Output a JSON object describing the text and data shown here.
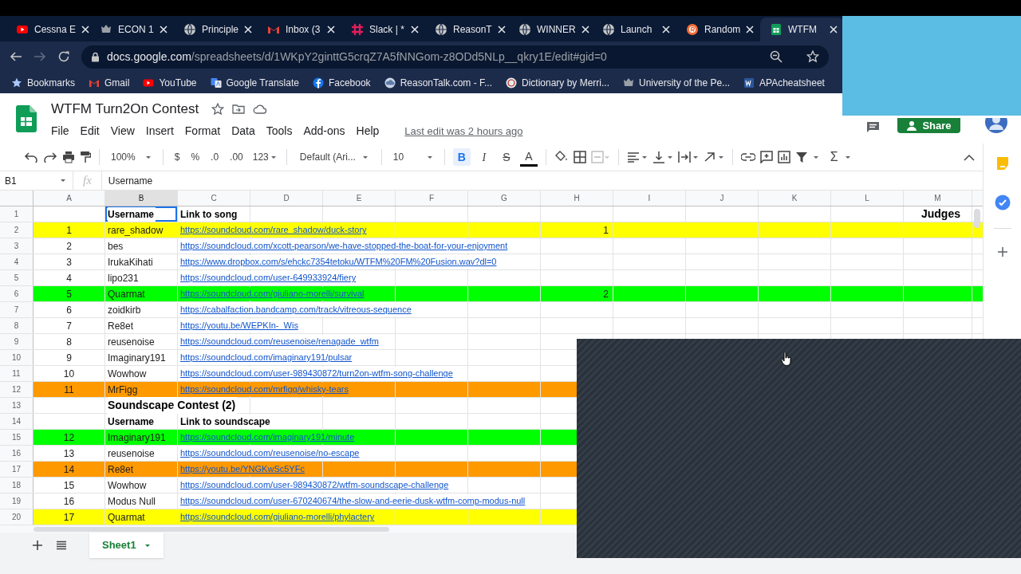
{
  "browser": {
    "tabs": [
      {
        "title": "Cessna E",
        "selected": false
      },
      {
        "title": "ECON 1",
        "selected": false
      },
      {
        "title": "Principle",
        "selected": false
      },
      {
        "title": "Inbox (3",
        "selected": false
      },
      {
        "title": "Slack | *",
        "selected": false
      },
      {
        "title": "ReasonT",
        "selected": false
      },
      {
        "title": "WINNER",
        "selected": false
      },
      {
        "title": "Launch",
        "selected": false
      },
      {
        "title": "Random",
        "selected": false
      },
      {
        "title": "WTFM",
        "selected": true
      }
    ],
    "url": "docs.google.com/spreadsheets/d/1WKpY2ginttG5crqZ7A5fNNGom-z8ODd5NLp__qkry1E/edit#gid=0",
    "bookmarks": [
      "Bookmarks",
      "Gmail",
      "YouTube",
      "Google Translate",
      "Facebook",
      "ReasonTalk.com - F...",
      "Dictionary by Merri...",
      "University of the Pe...",
      "APAcheatsheet"
    ]
  },
  "document": {
    "title": "WTFM Turn2On Contest",
    "menu": [
      "File",
      "Edit",
      "View",
      "Insert",
      "Format",
      "Data",
      "Tools",
      "Add-ons",
      "Help"
    ],
    "last_edit": "Last edit was 2 hours ago",
    "share": "Share"
  },
  "toolbar": {
    "zoom": "100%",
    "currency": "$",
    "percent": "%",
    "decimal_less": ".0",
    "decimal_more": ".00",
    "number_format": "123",
    "font": "Default (Ari...",
    "font_size": "10",
    "bold": {
      "label": "B",
      "on": true
    },
    "italic": "I",
    "strikethrough": "S",
    "text_color": "A",
    "functions": "Σ"
  },
  "formula_bar": {
    "cell": "B1",
    "fx": "fx",
    "content": "Username"
  },
  "columns": [
    {
      "label": "A",
      "selected": false
    },
    {
      "label": "B",
      "selected": true
    },
    {
      "label": "C",
      "selected": false
    },
    {
      "label": "D",
      "selected": false
    },
    {
      "label": "E",
      "selected": false
    },
    {
      "label": "F",
      "selected": false
    },
    {
      "label": "G",
      "selected": false
    },
    {
      "label": "H",
      "selected": false
    },
    {
      "label": "I",
      "selected": false
    },
    {
      "label": "J",
      "selected": false
    },
    {
      "label": "K",
      "selected": false
    },
    {
      "label": "L",
      "selected": false
    },
    {
      "label": "M",
      "selected": false
    }
  ],
  "rows": [
    {
      "number": "1",
      "cells": {
        "b": {
          "kind": "heading",
          "text": "Username",
          "selected": true
        },
        "c": {
          "kind": "heading",
          "text": "Link to song",
          "selected": false
        },
        "m": {
          "kind": "judges",
          "text": "Judges",
          "selected": false
        }
      }
    },
    {
      "number": "2",
      "color": "#ffff00",
      "cells": {
        "a": {
          "kind": "number",
          "text": "1",
          "selected": false
        },
        "b": {
          "kind": "text",
          "text": "rare_shadow",
          "selected": false
        },
        "c": {
          "kind": "link",
          "text": "https://soundcloud.com/rare_shadow/duck-story",
          "selected": false
        },
        "h": {
          "kind": "value",
          "text": "1",
          "selected": false
        }
      }
    },
    {
      "number": "3",
      "cells": {
        "a": {
          "kind": "number",
          "text": "2",
          "selected": false
        },
        "b": {
          "kind": "text",
          "text": "bes",
          "selected": false
        },
        "c": {
          "kind": "link",
          "text": "https://soundcloud.com/xcott-pearson/we-have-stopped-the-boat-for-your-enjoyment",
          "selected": false
        }
      }
    },
    {
      "number": "4",
      "cells": {
        "a": {
          "kind": "number",
          "text": "3",
          "selected": false
        },
        "b": {
          "kind": "text",
          "text": "IrukaKihati",
          "selected": false
        },
        "c": {
          "kind": "link",
          "text": "https://www.dropbox.com/s/ehckc7354tetoku/WTFM%20FM%20Fusion.wav?dl=0",
          "selected": false
        }
      }
    },
    {
      "number": "5",
      "cells": {
        "a": {
          "kind": "number",
          "text": "4",
          "selected": false
        },
        "b": {
          "kind": "text",
          "text": "lipo231",
          "selected": false
        },
        "c": {
          "kind": "link",
          "text": "https://soundcloud.com/user-649933924/fiery",
          "selected": false
        }
      }
    },
    {
      "number": "6",
      "color": "#00ff00",
      "cells": {
        "a": {
          "kind": "number",
          "text": "5",
          "selected": false
        },
        "b": {
          "kind": "text",
          "text": "Quarmat",
          "selected": false
        },
        "c": {
          "kind": "link",
          "text": "https://soundcloud.com/giuliano-morelli/survival",
          "selected": false
        },
        "h": {
          "kind": "value",
          "text": "2",
          "selected": false
        }
      }
    },
    {
      "number": "7",
      "cells": {
        "a": {
          "kind": "number",
          "text": "6",
          "selected": false
        },
        "b": {
          "kind": "text",
          "text": "zoidkirb",
          "selected": false
        },
        "c": {
          "kind": "link",
          "text": "https://cabalfaction.bandcamp.com/track/vitreous-sequence",
          "selected": false
        }
      }
    },
    {
      "number": "8",
      "cells": {
        "a": {
          "kind": "number",
          "text": "7",
          "selected": false
        },
        "b": {
          "kind": "text",
          "text": "Re8et",
          "selected": false
        },
        "c": {
          "kind": "link",
          "text": "https://youtu.be/WEPKIn-_Wis",
          "selected": false
        }
      }
    },
    {
      "number": "9",
      "cells": {
        "a": {
          "kind": "number",
          "text": "8",
          "selected": false
        },
        "b": {
          "kind": "text",
          "text": "reusenoise",
          "selected": false
        },
        "c": {
          "kind": "link",
          "text": "https://soundcloud.com/reusenoise/renagade_wtfm",
          "selected": false
        }
      }
    },
    {
      "number": "10",
      "cells": {
        "a": {
          "kind": "number",
          "text": "9",
          "selected": false
        },
        "b": {
          "kind": "text",
          "text": "Imaginary191",
          "selected": false
        },
        "c": {
          "kind": "link",
          "text": "https://soundcloud.com/imaginary191/pulsar",
          "selected": false
        }
      }
    },
    {
      "number": "11",
      "cells": {
        "a": {
          "kind": "number",
          "text": "10",
          "selected": false
        },
        "b": {
          "kind": "text",
          "text": "Wowhow",
          "selected": false
        },
        "c": {
          "kind": "link",
          "text": "https://soundcloud.com/user-989430872/turn2on-wtfm-song-challenge",
          "selected": false
        }
      }
    },
    {
      "number": "12",
      "color": "#ff9900",
      "cells": {
        "a": {
          "kind": "number",
          "text": "11",
          "selected": false
        },
        "b": {
          "kind": "text",
          "text": "MrFigg",
          "selected": false
        },
        "c": {
          "kind": "link",
          "text": "https://soundcloud.com/mrfigg/whisky-tears",
          "selected": false
        }
      }
    },
    {
      "number": "13",
      "cells": {
        "b": {
          "kind": "title",
          "text": "Soundscape Contest (2)",
          "selected": false
        }
      }
    },
    {
      "number": "14",
      "cells": {
        "b": {
          "kind": "heading",
          "text": "Username",
          "selected": false
        },
        "c": {
          "kind": "heading",
          "text": "Link to soundscape",
          "selected": false
        }
      }
    },
    {
      "number": "15",
      "color": "#00ff00",
      "cells": {
        "a": {
          "kind": "number",
          "text": "12",
          "selected": false
        },
        "b": {
          "kind": "text",
          "text": "Imaginary191",
          "selected": false
        },
        "c": {
          "kind": "link",
          "text": "https://soundcloud.com/imaginary191/minute",
          "selected": false
        }
      }
    },
    {
      "number": "16",
      "cells": {
        "a": {
          "kind": "number",
          "text": "13",
          "selected": false
        },
        "b": {
          "kind": "text",
          "text": "reusenoise",
          "selected": false
        },
        "c": {
          "kind": "link",
          "text": "https://soundcloud.com/reusenoise/no-escape",
          "selected": false
        }
      }
    },
    {
      "number": "17",
      "color": "#ff9900",
      "cells": {
        "a": {
          "kind": "number",
          "text": "14",
          "selected": false
        },
        "b": {
          "kind": "text",
          "text": "Re8et",
          "selected": false
        },
        "c": {
          "kind": "link",
          "text": "https://youtu.be/YNGKwSc5YFc",
          "selected": false
        }
      }
    },
    {
      "number": "18",
      "cells": {
        "a": {
          "kind": "number",
          "text": "15",
          "selected": false
        },
        "b": {
          "kind": "text",
          "text": "Wowhow",
          "selected": false
        },
        "c": {
          "kind": "link",
          "text": "https://soundcloud.com/user-989430872/wtfm-soundscape-challenge",
          "selected": false
        }
      }
    },
    {
      "number": "19",
      "cells": {
        "a": {
          "kind": "number",
          "text": "16",
          "selected": false
        },
        "b": {
          "kind": "text",
          "text": "Modus Null",
          "selected": false
        },
        "c": {
          "kind": "link",
          "text": "https://soundcloud.com/user-670240674/the-slow-and-eerie-dusk-wtfm-comp-modus-null",
          "selected": false
        }
      }
    },
    {
      "number": "20",
      "color": "#ffff00",
      "cells": {
        "a": {
          "kind": "number",
          "text": "17",
          "selected": false
        },
        "b": {
          "kind": "text",
          "text": "Quarmat",
          "selected": false
        },
        "c": {
          "kind": "link",
          "text": "https://soundcloud.com/giuliano-morelli/phylactery",
          "selected": false
        }
      }
    }
  ],
  "sheets": [
    {
      "label": "Sheet1",
      "selected": true
    }
  ]
}
